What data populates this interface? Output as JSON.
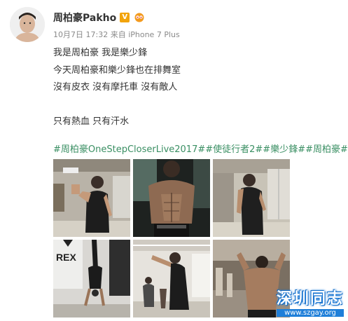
{
  "user": {
    "name": "周柏豪Pakho",
    "verified_icon": "verified-v-icon",
    "member_icon": "weibo-member-icon"
  },
  "post": {
    "date": "10月7日 17:32",
    "source": "来自 iPhone 7 Plus",
    "lines": [
      "我是周柏豪 我是樂少鋒",
      "今天周柏豪和樂少鋒也在排舞室",
      "沒有皮衣 沒有摩托車 沒有敵人",
      "",
      "只有熱血 只有汗水",
      ""
    ],
    "hashtags": "#周柏豪OneStepCloserLive2017##使徒行者2##樂少鋒##周柏豪#"
  },
  "photos": [
    {
      "name": "photo-1"
    },
    {
      "name": "photo-2"
    },
    {
      "name": "photo-3"
    },
    {
      "name": "photo-4"
    },
    {
      "name": "photo-5"
    },
    {
      "name": "photo-6"
    }
  ],
  "watermark": {
    "title": "深圳同志",
    "url": "www.szgay.org"
  },
  "colors": {
    "hashtag": "#3a8f63",
    "verified": "#f2a40c",
    "watermark_blue": "#1f7fd9"
  }
}
